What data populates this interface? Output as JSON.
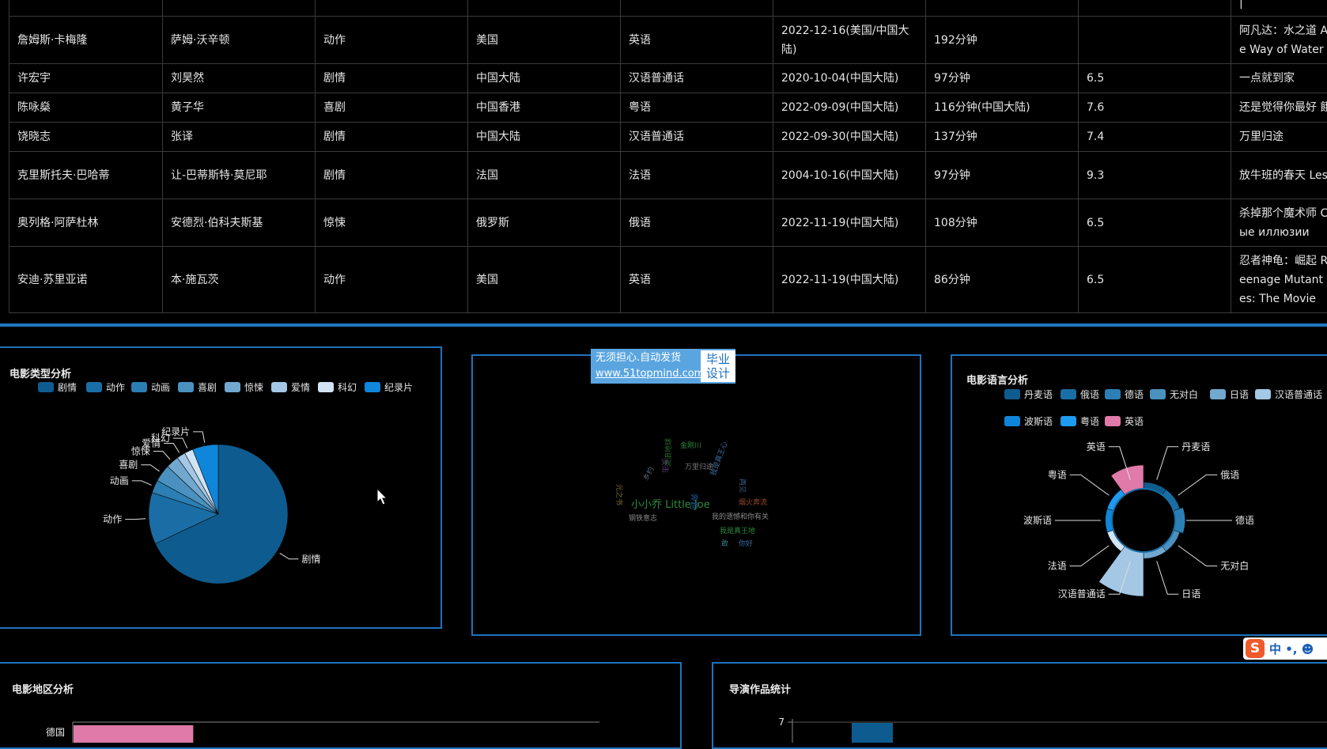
{
  "table": {
    "rows": [
      [
        "",
        "",
        "",
        "",
        "",
        "",
        "",
        "",
        "",
        "|"
      ],
      [
        "詹姆斯·卡梅隆",
        "萨姆·沃辛顿",
        "动作",
        "美国",
        "英语",
        "2022-12-16(美国/中国大陆)",
        "192分钟",
        "",
        "",
        "阿凡达：水之道 Av e Way of Water"
      ],
      [
        "许宏宇",
        "刘昊然",
        "剧情",
        "中国大陆",
        "汉语普通话",
        "2020-10-04(中国大陆)",
        "97分钟",
        "6.5",
        "",
        "一点就到家"
      ],
      [
        "陈咏燊",
        "黄子华",
        "喜剧",
        "中国香港",
        "粤语",
        "2022-09-09(中国大陆)",
        "116分钟(中国大陆)",
        "7.6",
        "",
        "还是觉得你最好 餓"
      ],
      [
        "饶晓志",
        "张译",
        "剧情",
        "中国大陆",
        "汉语普通话",
        "2022-09-30(中国大陆)",
        "137分钟",
        "7.4",
        "",
        "万里归途"
      ],
      [
        "克里斯托夫·巴哈蒂",
        "让-巴蒂斯特·莫尼耶",
        "剧情",
        "法国",
        "法语",
        "2004-10-16(中国大陆)",
        "97分钟",
        "9.3",
        "",
        "放牛班的春天 Les s"
      ],
      [
        "奥列格·阿萨杜林",
        "安德烈·伯科夫斯基",
        "惊悚",
        "俄罗斯",
        "俄语",
        "2022-11-19(中国大陆)",
        "108分钟",
        "6.5",
        "",
        "杀掉那个魔术师 С ные иллюзии"
      ],
      [
        "安迪·苏里亚诺",
        "本·施瓦茨",
        "动作",
        "美国",
        "英语",
        "2022-11-19(中国大陆)",
        "86分钟",
        "6.5",
        "",
        "忍者神龟：崛起 R Teenage Mutant rtles: The Movie"
      ]
    ]
  },
  "watermark": {
    "line1": "无须担心.自动发货",
    "line2": "www.51topmind.com",
    "badge1": "毕业",
    "badge2": "设计"
  },
  "genre_panel": {
    "title": "电影类型分析",
    "legend": [
      "剧情",
      "动作",
      "动画",
      "喜剧",
      "惊悚",
      "爱情",
      "科幻",
      "纪录片"
    ],
    "colors": [
      "#0e5c8f",
      "#1a6ea5",
      "#2b7fb4",
      "#4a91c0",
      "#72a8d0",
      "#a3c7e4",
      "#d2e4f3",
      "#0f86d9"
    ],
    "chart_data": {
      "type": "pie",
      "categories": [
        "剧情",
        "动作",
        "动画",
        "喜剧",
        "惊悚",
        "爱情",
        "科幻",
        "纪录片"
      ],
      "values": [
        68,
        12,
        3,
        4,
        3,
        2,
        2,
        6
      ]
    }
  },
  "wordcloud_panel": {
    "words": [
      {
        "text": "小小乔 Little Joe",
        "color": "#2e8b3a",
        "size": 13
      },
      {
        "text": "金刚川",
        "color": "#2d8a3e",
        "size": 9
      },
      {
        "text": "万里归途",
        "color": "#7a7a7a",
        "size": 9
      },
      {
        "text": "我是真王心",
        "color": "#3a6a9a",
        "size": 9
      },
      {
        "text": "再见",
        "color": "#3a5f8a",
        "size": 9
      },
      {
        "text": "钢铁意志",
        "color": "#888",
        "size": 9
      },
      {
        "text": "我的遗憾和你有关",
        "color": "#888",
        "size": 9
      },
      {
        "text": "我是真王地",
        "color": "#2a8a3a",
        "size": 9
      },
      {
        "text": "敢",
        "color": "#3a7a8a",
        "size": 9
      },
      {
        "text": "你好",
        "color": "#3a6a9a",
        "size": 9
      },
      {
        "text": "奔跑",
        "color": "#1f5a9a",
        "size": 10
      },
      {
        "text": "烟火奔流",
        "color": "#9a4a2a",
        "size": 9
      },
      {
        "text": "元之书",
        "color": "#7a6a2a",
        "size": 9
      },
      {
        "text": "反击",
        "color": "#5a3a7a",
        "size": 9
      },
      {
        "text": "乡约",
        "color": "#5a6a7a",
        "size": 9
      },
      {
        "text": "流浪地球",
        "color": "#2e6a2e",
        "size": 9
      }
    ]
  },
  "language_panel": {
    "title": "电影语言分析",
    "legend": [
      "丹麦语",
      "俄语",
      "德语",
      "无对白",
      "日语",
      "汉语普通话",
      "法语",
      "波斯语",
      "粤语",
      "英语"
    ],
    "colors": [
      "#0e5c8f",
      "#1a6ea5",
      "#2b7fb4",
      "#4a91c0",
      "#72a8d0",
      "#a3c7e4",
      "#d2e4f3",
      "#0f86d9",
      "#1e9bf0",
      "#e07aa8"
    ],
    "chart_data": {
      "type": "pie",
      "subtype": "rose",
      "categories": [
        "丹麦语",
        "俄语",
        "德语",
        "无对白",
        "日语",
        "汉语普通话",
        "法语",
        "波斯语",
        "粤语",
        "英语"
      ],
      "values": [
        1,
        1,
        2,
        1,
        1,
        12,
        1,
        1,
        1,
        6
      ]
    }
  },
  "region_panel": {
    "title": "电影地区分析",
    "chart_data": {
      "type": "bar",
      "orientation": "horizontal",
      "categories": [
        "德国"
      ],
      "values": [
        1
      ],
      "colors": [
        "#e07aa8"
      ]
    }
  },
  "director_panel": {
    "title": "导演作品统计",
    "chart_data": {
      "type": "bar",
      "ytick_top": "7",
      "values": [
        7
      ],
      "colors": [
        "#0e5c8f"
      ]
    }
  },
  "ime": {
    "logo": "S",
    "text": "中 •, ☻"
  }
}
